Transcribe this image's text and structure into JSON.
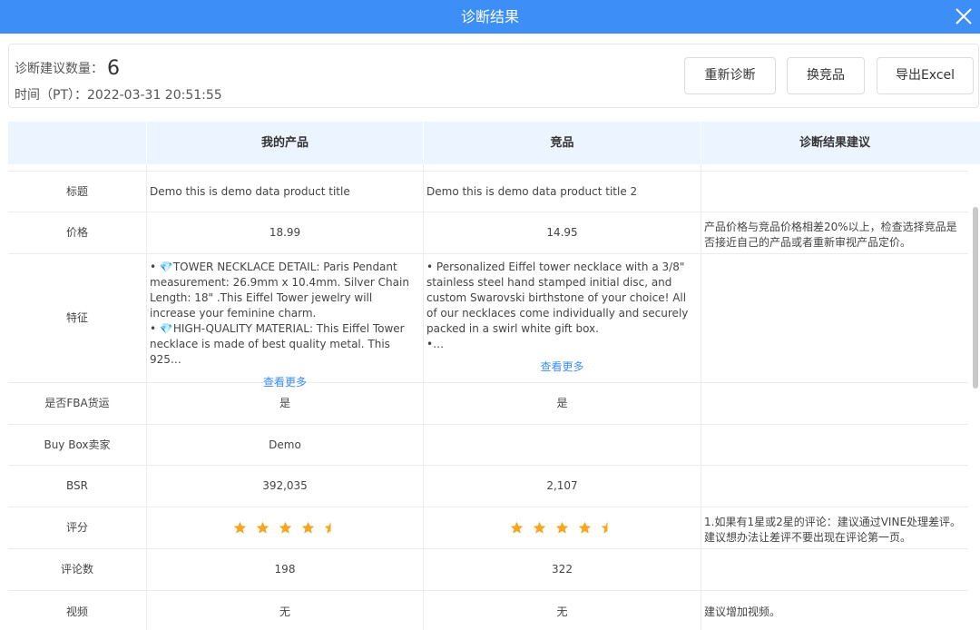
{
  "dialog": {
    "title": "诊断结果"
  },
  "summary": {
    "count_label": "诊断建议数量：",
    "count_value": "6",
    "time_label": "时间（PT）：",
    "time_value": "2022-03-31 20:51:55"
  },
  "actions": {
    "rediagnose": "重新诊断",
    "swap_competitor": "换竞品",
    "export_excel": "导出Excel"
  },
  "table": {
    "headers": [
      "",
      "我的产品",
      "竞品",
      "诊断结果建议"
    ],
    "rows": {
      "title": {
        "label": "标题",
        "mine": "Demo this is demo data product title",
        "competitor": "Demo this is demo data product title 2",
        "advice": ""
      },
      "price": {
        "label": "价格",
        "mine": "18.99",
        "competitor": "14.95",
        "advice": "产品价格与竞品价格相差20%以上，检查选择竞品是否接近自己的产品或者重新审视产品定价。"
      },
      "features": {
        "label": "特征",
        "mine": "• 💎TOWER NECKLACE DETAIL: Paris Pendant measurement: 26.9mm x 10.4mm. Silver Chain Length: 18\" .This Eiffel Tower jewelry will increase your feminine charm.\n• 💎HIGH-QUALITY MATERIAL: This Eiffel Tower necklace is made of best quality metal. This 925…",
        "competitor": "• Personalized Eiffel tower necklace with a 3/8\" stainless steel hand stamped initial disc, and custom Swarovski birthstone of your choice! All of our necklaces come individually and securely packed in a swirl white gift box.\n•…",
        "more": "查看更多",
        "advice": ""
      },
      "fba": {
        "label": "是否FBA货运",
        "mine": "是",
        "competitor": "是",
        "advice": ""
      },
      "buybox": {
        "label": "Buy Box卖家",
        "mine": "Demo",
        "competitor": "",
        "advice": ""
      },
      "bsr": {
        "label": "BSR",
        "mine": "392,035",
        "competitor": "2,107",
        "advice": ""
      },
      "rating": {
        "label": "评分",
        "mine_stars": 4.5,
        "competitor_stars": 4.5,
        "advice": "1.如果有1星或2星的评论：建议通过VINE处理差评。建议想办法让差评不要出现在评论第一页。"
      },
      "reviews": {
        "label": "评论数",
        "mine": "198",
        "competitor": "322",
        "advice": ""
      },
      "video": {
        "label": "视频",
        "mine": "无",
        "competitor": "无",
        "advice": "建议增加视频。"
      }
    }
  },
  "colors": {
    "header_blue": "#3d8ef7",
    "table_head_bg": "#ebf4ff",
    "star": "#f5a623",
    "link": "#3d8ef7"
  }
}
